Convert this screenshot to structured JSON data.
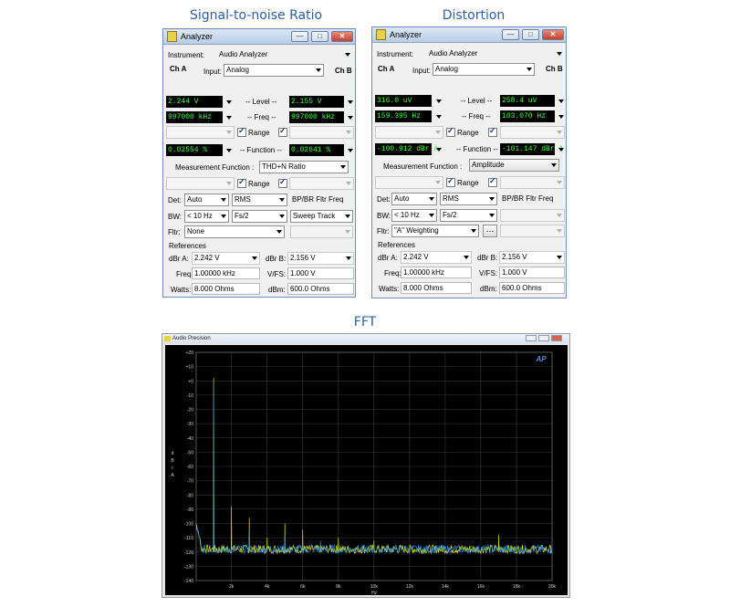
{
  "headings": {
    "snr": "Signal-to-noise Ratio",
    "distortion": "Distortion",
    "fft": "FFT"
  },
  "panels": [
    {
      "window_title": "Analyzer",
      "instrument_label": "Instrument:",
      "instrument": "Audio Analyzer",
      "ch_a": "Ch A",
      "ch_b": "Ch B",
      "input_label": "Input:",
      "input": "Analog",
      "level_a": "2.244  V",
      "level_label": "-- Level --",
      "level_b": "2.155  V",
      "freq_a": "997000 kHz",
      "freq_label": "-- Freq --",
      "freq_b": "997000 kHz",
      "range_label": "Range",
      "function_a": "0.02554  %",
      "function_label": "-- Function --",
      "function_b": "0.02641  %",
      "measurement_function_label": "Measurement Function :",
      "measurement_function": "THD+N Ratio",
      "range2_label": "Range",
      "det_label": "Det:",
      "det": "Auto",
      "det_type": "RMS",
      "bpbr_label": "BP/BR Fltr Freq",
      "bw_label": "BW:",
      "bw": "< 10 Hz",
      "bw_hi": "Fs/2",
      "bpbr_value": "Sweep Track",
      "fltr_label": "Fltr:",
      "fltr": "None",
      "references_label": "References",
      "dbra_label": "dBr A:",
      "dbra": "2.242   V",
      "dbrb_label": "dBr B:",
      "dbrb": "2.156   V",
      "freq_ref_label": "Freq:",
      "freq_ref": "1.00000 kHz",
      "vfs_label": "V/FS:",
      "vfs": "1.000    V",
      "watts_label": "Watts:",
      "watts": "8.000    Ohms",
      "dbm_label": "dBm:",
      "dbm": "600.0    Ohms"
    },
    {
      "window_title": "Analyzer",
      "instrument_label": "Instrument:",
      "instrument": "Audio Analyzer",
      "ch_a": "Ch A",
      "ch_b": "Ch B",
      "input_label": "Input:",
      "input": "Analog",
      "level_a": "316.0  uV",
      "level_label": "-- Level --",
      "level_b": "258.4  uV",
      "freq_a": "159.395  Hz",
      "freq_label": "-- Freq --",
      "freq_b": "103.070  Hz",
      "range_label": "Range",
      "function_a": "-100.912 dBr A",
      "function_label": "-- Function --",
      "function_b": "-101.147 dBr A",
      "measurement_function_label": "Measurement Function :",
      "measurement_function": "Amplitude",
      "range2_label": "Range",
      "det_label": "Det:",
      "det": "Auto",
      "det_type": "RMS",
      "bpbr_label": "BP/BR Fltr Freq",
      "bw_label": "BW:",
      "bw": "< 10 Hz",
      "bw_hi": "Fs/2",
      "bpbr_value": "",
      "fltr_label": "Fltr:",
      "fltr": "\"A\" Weighting",
      "references_label": "References",
      "dbra_label": "dBr A:",
      "dbra": "2.242   V",
      "dbrb_label": "dBr B:",
      "dbrb": "2.156   V",
      "freq_ref_label": "Freq:",
      "freq_ref": "1.00000 kHz",
      "vfs_label": "V/FS:",
      "vfs": "1.000    V",
      "watts_label": "Watts:",
      "watts": "8.000    Ohms",
      "dbm_label": "dBm:",
      "dbm": "600.0    Ohms"
    }
  ],
  "window_buttons": {
    "minimize": "—",
    "maximize": "□",
    "close": "✕"
  },
  "fft_window": {
    "title": "Audio Precision",
    "logo": "AP"
  },
  "colors": {
    "heading": "#2c5fa8",
    "trace_a": "#e6e600",
    "trace_b": "#33a0ff",
    "readout": "#3cff3c"
  },
  "chart_data": {
    "type": "line",
    "title": "",
    "xlabel": "Hz",
    "ylabel": "d B r A",
    "x_ticks": [
      "2k",
      "4k",
      "6k",
      "8k",
      "10k",
      "12k",
      "14k",
      "16k",
      "18k",
      "20k"
    ],
    "y_ticks": [
      "+20",
      "+10",
      "+0",
      "-10",
      "-20",
      "-30",
      "-40",
      "-50",
      "-60",
      "-70",
      "-80",
      "-90",
      "-100",
      "-110",
      "-120",
      "-130",
      "-140"
    ],
    "xlim": [
      20,
      20000
    ],
    "ylim": [
      -140,
      20
    ],
    "grid": true,
    "noise_floor_db": -118,
    "series": [
      {
        "color": "#e6e600",
        "peaks": [
          [
            1000,
            2
          ],
          [
            2000,
            -88
          ],
          [
            3000,
            -96
          ],
          [
            4000,
            -110
          ],
          [
            5000,
            -100
          ],
          [
            6000,
            -104
          ],
          [
            8000,
            -110
          ],
          [
            10000,
            -112
          ],
          [
            17000,
            -108
          ]
        ]
      },
      {
        "color": "#33a0ff",
        "peaks": [
          [
            1000,
            -2
          ],
          [
            3000,
            -104
          ],
          [
            5000,
            -108
          ],
          [
            7000,
            -112
          ]
        ]
      }
    ]
  }
}
